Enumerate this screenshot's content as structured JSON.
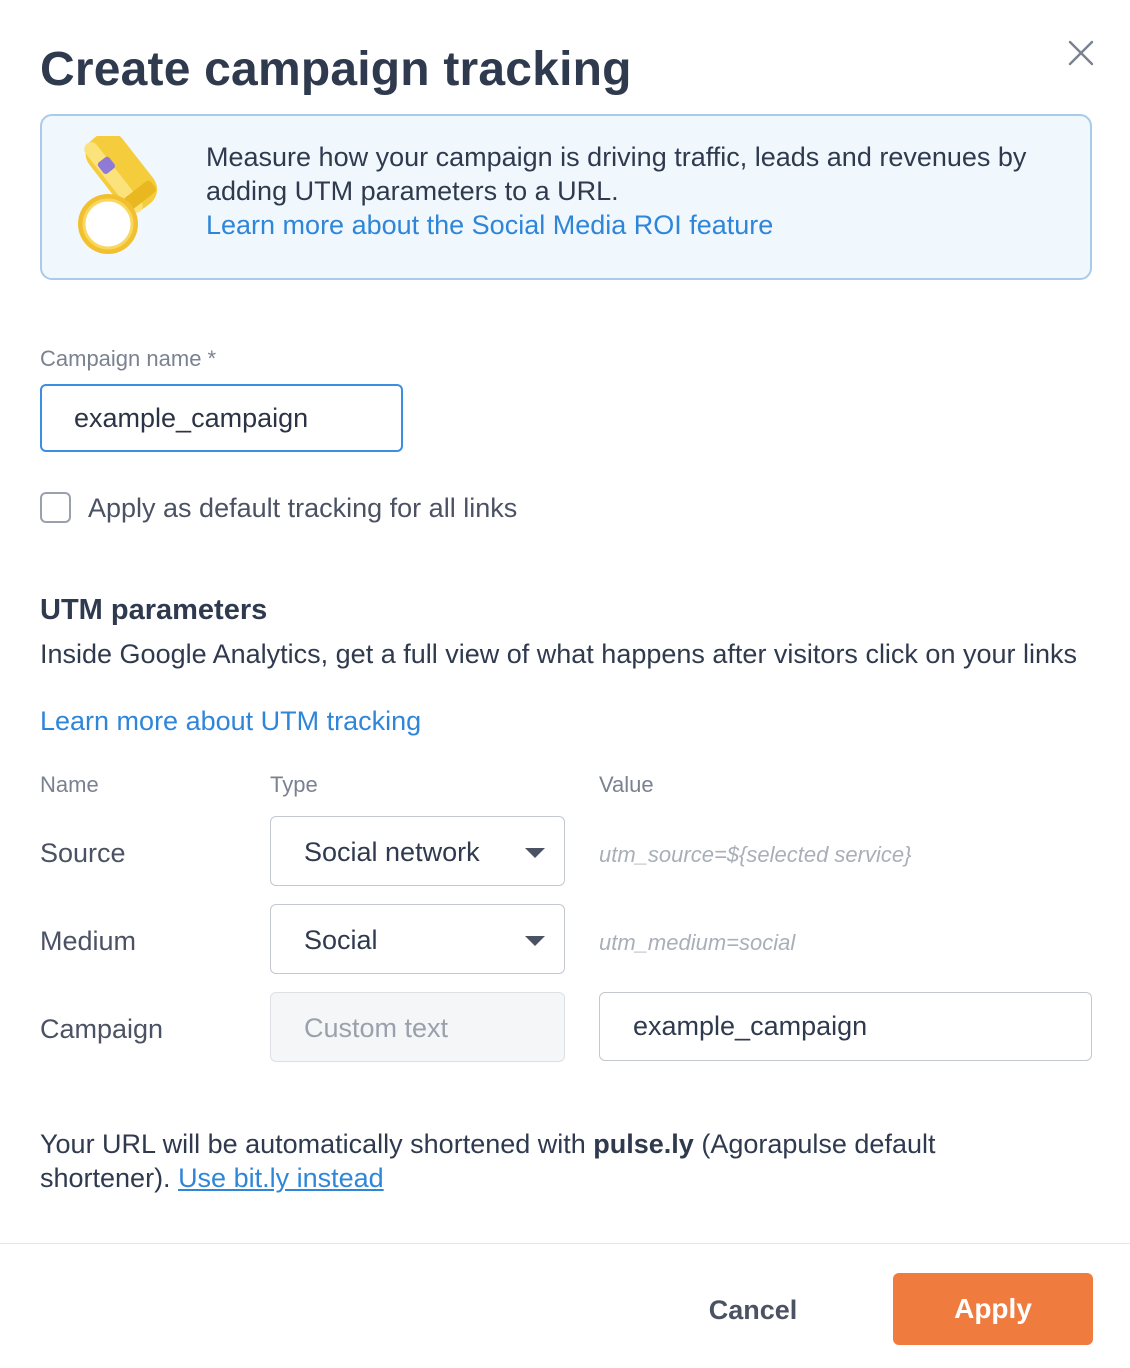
{
  "dialog": {
    "title": "Create campaign tracking"
  },
  "banner": {
    "text": "Measure how your campaign is driving traffic, leads and revenues by adding UTM parameters to a URL.",
    "link": "Learn more about the Social Media ROI feature"
  },
  "campaign_name": {
    "label": "Campaign name *",
    "value": "example_campaign"
  },
  "default_tracking": {
    "label": "Apply as default tracking for all links",
    "checked": false
  },
  "utm": {
    "title": "UTM parameters",
    "description": "Inside Google Analytics, get a full view of what happens after visitors click on your links",
    "link": "Learn more about UTM tracking",
    "columns": {
      "name": "Name",
      "type": "Type",
      "value": "Value"
    },
    "rows": [
      {
        "name": "Source",
        "type": "Social network",
        "value": "utm_source=${selected service}"
      },
      {
        "name": "Medium",
        "type": "Social",
        "value": "utm_medium=social"
      },
      {
        "name": "Campaign",
        "type_placeholder": "Custom text",
        "value": "example_campaign"
      }
    ]
  },
  "shortener": {
    "prefix": "Your URL will be automatically shortened with ",
    "service": "pulse.ly",
    "suffix": " (Agorapulse default shortener). ",
    "link": "Use bit.ly instead"
  },
  "footer": {
    "cancel_label": "Cancel",
    "apply_label": "Apply"
  },
  "colors": {
    "accent": "#2f86d9",
    "primary_button": "#ef7b3f",
    "banner_bg": "#f0f7fd"
  },
  "icons": {
    "close": "close-icon",
    "illustration": "flashlight-icon",
    "dropdown": "chevron-down-icon"
  }
}
